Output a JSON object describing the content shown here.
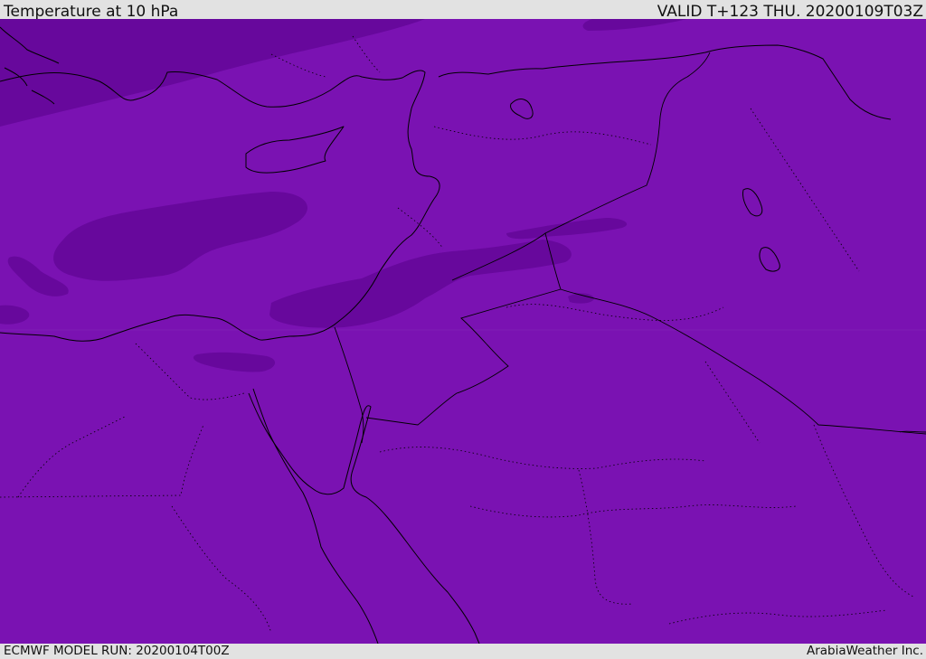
{
  "header": {
    "title": "Temperature at 10 hPa",
    "valid_time": "VALID T+123 THU. 20200109T03Z"
  },
  "footer": {
    "model_run": "ECMWF MODEL RUN: 20200104T00Z",
    "credit": "ArabiaWeather Inc."
  },
  "colors": {
    "field_base": "#7a12b2",
    "field_cold": "#67089c",
    "coastline": "#000000",
    "bar_background": "#e2e2e2"
  }
}
